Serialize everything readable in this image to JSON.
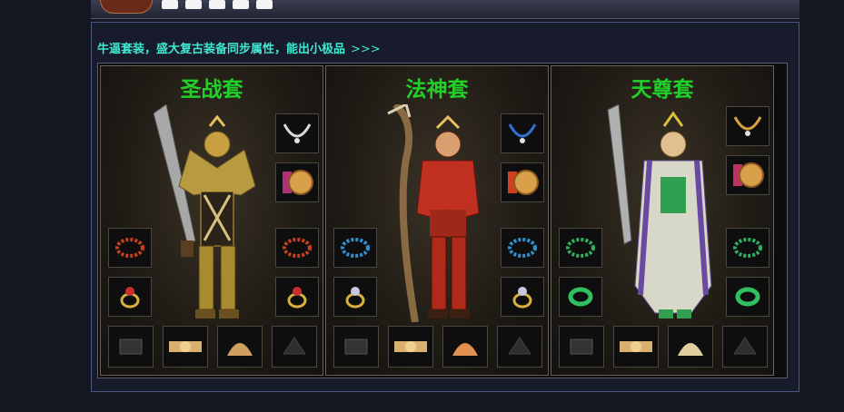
{
  "banner": {
    "title": ""
  },
  "intro": {
    "text": "牛逼套装，盛大复古装备同步属性，能出小极品",
    "arrows": ">>>"
  },
  "colors": {
    "intro_text": "#3fe8d0",
    "set_title": "#22d02a",
    "panel_border": "#4a5880"
  },
  "sets": [
    {
      "name": "圣战套",
      "armor_color": "#c8a040",
      "weapon": "broadsword-icon"
    },
    {
      "name": "法神套",
      "armor_color": "#c03020",
      "weapon": "staff-icon"
    },
    {
      "name": "天尊套",
      "armor_color": "#d8d8c8",
      "weapon": "longsword-icon"
    }
  ]
}
